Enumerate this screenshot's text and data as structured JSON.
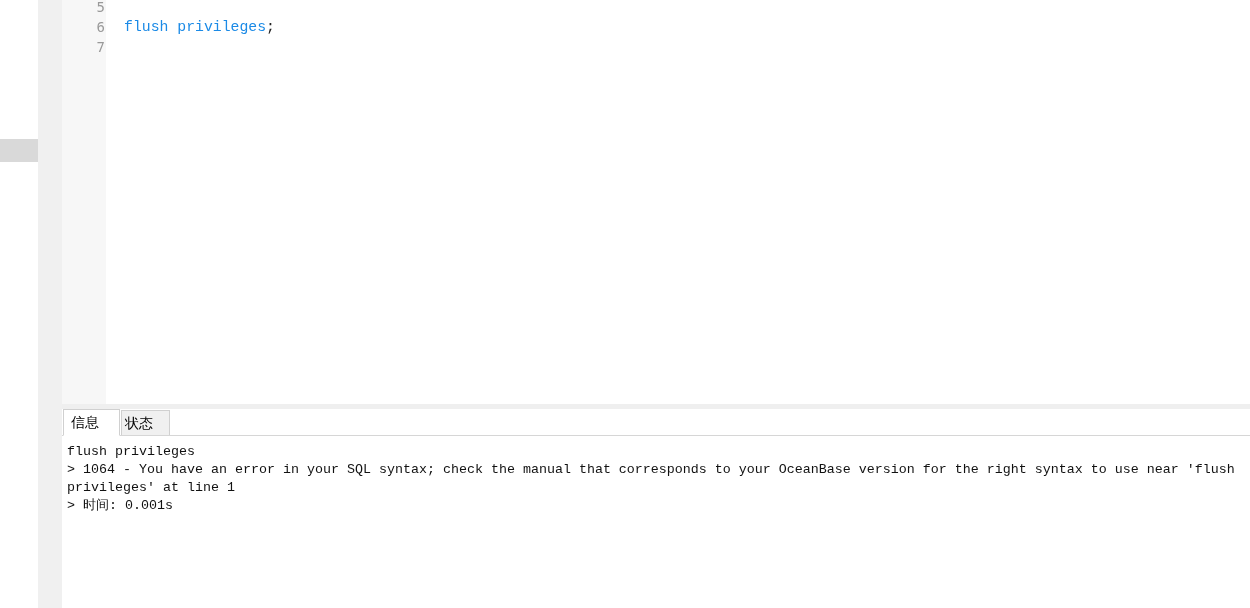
{
  "editor": {
    "lines": [
      {
        "number": "5"
      },
      {
        "number": "6",
        "tokens": [
          {
            "kind": "keyword",
            "text": "flush privileges"
          },
          {
            "kind": "punctuation",
            "text": ";"
          }
        ]
      },
      {
        "number": "7"
      }
    ]
  },
  "result_panel": {
    "tabs": [
      {
        "label": "信息",
        "selected": true
      },
      {
        "label": "状态",
        "selected": false
      }
    ],
    "messages": [
      "flush privileges",
      "> 1064 - You have an error in your SQL syntax; check the manual that corresponds to your OceanBase version for the right syntax to use near 'flush privileges' at line 1",
      "> 时间: 0.001s"
    ]
  }
}
